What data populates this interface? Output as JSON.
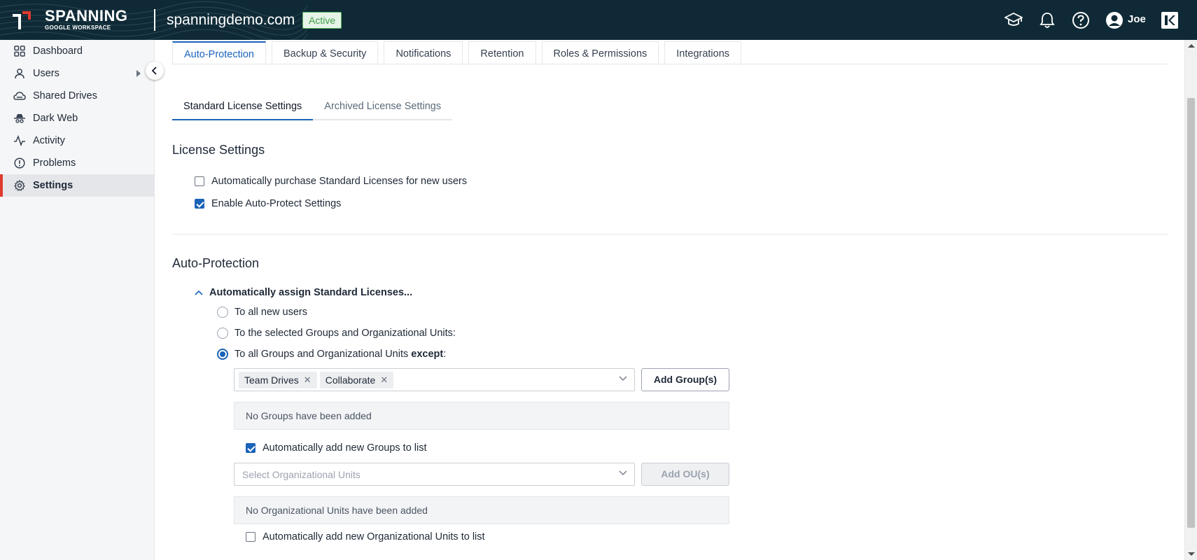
{
  "header": {
    "brand_name": "SPANNING",
    "brand_sub": "GOOGLE WORKSPACE",
    "domain": "spanningdemo.com",
    "status": "Active",
    "user": "Joe",
    "icons": [
      "graduation-cap-icon",
      "bell-icon",
      "help-icon",
      "user-avatar-icon",
      "kaseya-logo-icon"
    ]
  },
  "sidebar": {
    "items": [
      {
        "label": "Dashboard",
        "icon": "grid-icon"
      },
      {
        "label": "Users",
        "icon": "user-icon"
      },
      {
        "label": "Shared Drives",
        "icon": "cloud-drive-icon"
      },
      {
        "label": "Dark Web",
        "icon": "spy-icon"
      },
      {
        "label": "Activity",
        "icon": "activity-icon"
      },
      {
        "label": "Problems",
        "icon": "alert-circle-icon"
      },
      {
        "label": "Settings",
        "icon": "gear-icon"
      }
    ],
    "active": "Settings"
  },
  "tabs": [
    "Auto-Protection",
    "Backup & Security",
    "Notifications",
    "Retention",
    "Roles & Permissions",
    "Integrations"
  ],
  "subtabs": [
    "Standard License Settings",
    "Archived License Settings"
  ],
  "license_settings": {
    "title": "License Settings",
    "auto_purchase": {
      "label": "Automatically purchase Standard Licenses for new users",
      "checked": false
    },
    "enable_auto_protect": {
      "label": "Enable Auto-Protect Settings",
      "checked": true
    }
  },
  "auto_protection": {
    "title": "Auto-Protection",
    "accordion_label": "Automatically assign Standard Licenses...",
    "options": {
      "all_new_users": "To all new users",
      "selected": "To the selected Groups and Organizational Units:",
      "except_prefix": "To all Groups and Organizational Units ",
      "except_bold": "except",
      "except_suffix": ":"
    },
    "selected_option": "except",
    "group_chips": [
      "Team Drives",
      "Collaborate"
    ],
    "add_groups_label": "Add Group(s)",
    "no_groups_text": "No Groups have been added",
    "auto_add_groups": {
      "label": "Automatically add new Groups to list",
      "checked": true
    },
    "ou_placeholder": "Select Organizational Units",
    "add_ou_label": "Add OU(s)",
    "no_ou_text": "No Organizational Units have been added",
    "auto_add_ou": {
      "label": "Automatically add new Organizational Units to list",
      "checked": false
    }
  },
  "colors": {
    "header_bg": "#0f2a36",
    "accent": "#1a63b8",
    "active_marker": "#e03a2e",
    "status_green": "#3f9c44"
  }
}
